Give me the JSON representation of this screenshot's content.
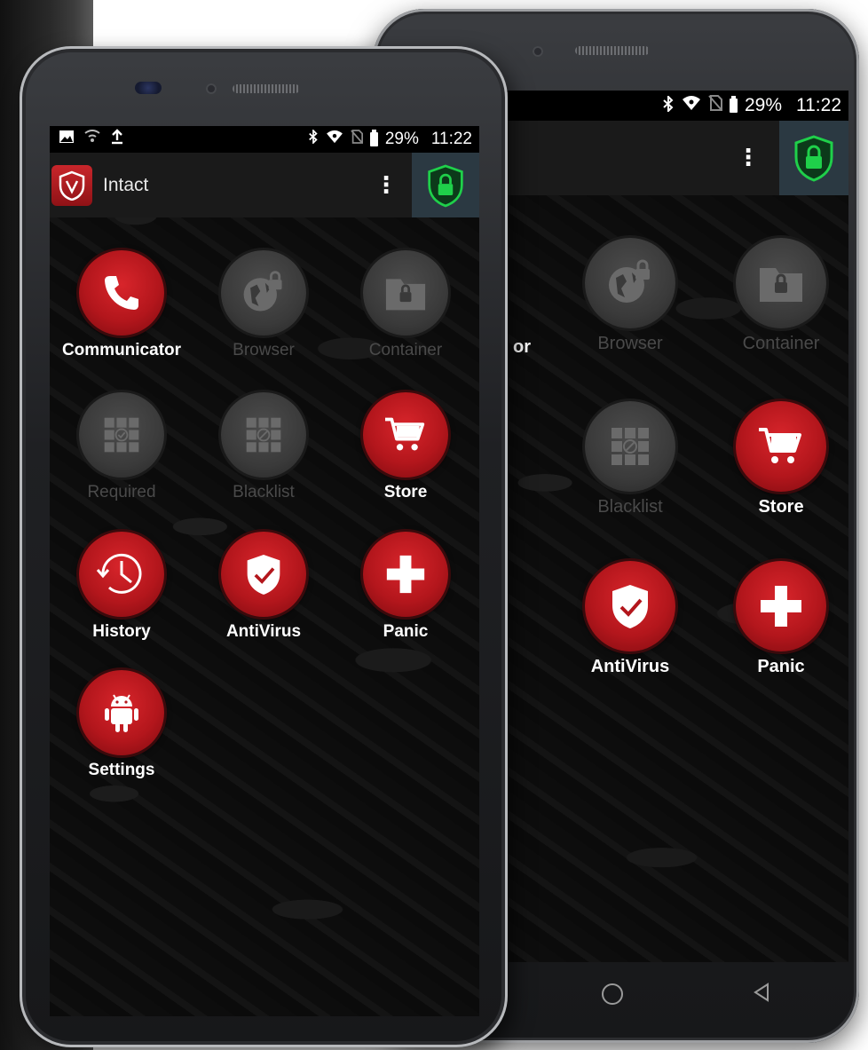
{
  "status_bar": {
    "battery": "29%",
    "time": "11:22",
    "left_icons": [
      "image-icon",
      "wifi-calling-icon",
      "upload-icon"
    ],
    "right_icons": [
      "bluetooth-icon",
      "wifi-icon",
      "no-sim-icon",
      "battery-icon"
    ]
  },
  "toolbar": {
    "app_name": "Intact",
    "menu_icon": "more-vert-icon",
    "lock_icon": "green-shield-lock-icon"
  },
  "front_apps": [
    {
      "label": "Communicator",
      "icon": "phone-icon",
      "enabled": true
    },
    {
      "label": "Browser",
      "icon": "globe-lock-icon",
      "enabled": false
    },
    {
      "label": "Container",
      "icon": "folder-lock-icon",
      "enabled": false
    },
    {
      "label": "Required",
      "icon": "grid-check-icon",
      "enabled": false
    },
    {
      "label": "Blacklist",
      "icon": "grid-block-icon",
      "enabled": false
    },
    {
      "label": "Store",
      "icon": "cart-icon",
      "enabled": true
    },
    {
      "label": "History",
      "icon": "clock-history-icon",
      "enabled": true
    },
    {
      "label": "AntiVirus",
      "icon": "shield-check-icon",
      "enabled": true
    },
    {
      "label": "Panic",
      "icon": "plus-icon",
      "enabled": true
    },
    {
      "label": "Settings",
      "icon": "android-icon",
      "enabled": true
    }
  ],
  "back_phone": {
    "partial_label": "or",
    "apps": [
      {
        "label": "Browser",
        "enabled": false
      },
      {
        "label": "Container",
        "enabled": false
      },
      {
        "label": "Blacklist",
        "enabled": false
      },
      {
        "label": "Store",
        "enabled": true
      },
      {
        "label": "AntiVirus",
        "enabled": true
      },
      {
        "label": "Panic",
        "enabled": true
      }
    ],
    "nav_buttons": [
      "home-button",
      "back-button"
    ]
  },
  "colors": {
    "accent_red": "#c41e24",
    "lock_green": "#1fd04a",
    "toolbar_bg": "#1a1a1a",
    "lock_bg": "#2b3942",
    "disabled_text": "#4a4a4a"
  }
}
